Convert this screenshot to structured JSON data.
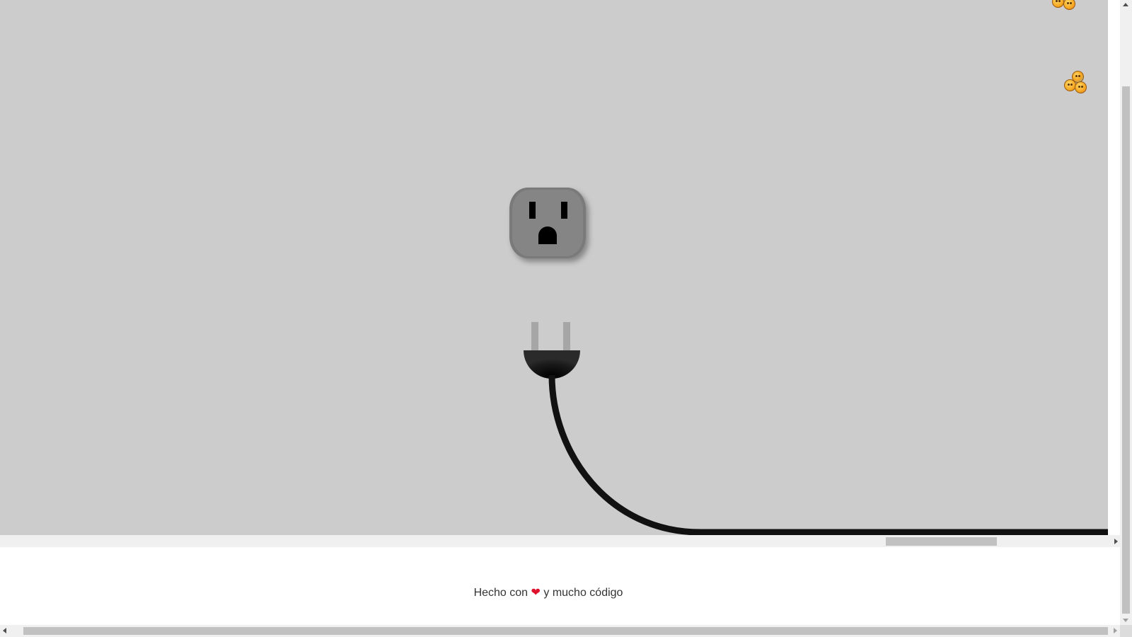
{
  "stage": {
    "background": "#cccccc"
  },
  "outlet": {
    "icon": "power-outlet-icon",
    "color": "#808080"
  },
  "plug": {
    "icon": "power-plug-icon",
    "color": "#111111",
    "prong_color": "#a6a6a6"
  },
  "emojis": [
    {
      "icon": "emoji-cluster-icon"
    },
    {
      "icon": "emoji-cluster-icon"
    }
  ],
  "footer": {
    "text_before": "Hecho con",
    "heart": "❤",
    "text_after": "y mucho código"
  },
  "colors": {
    "heart": "#e0112b",
    "footer_text": "#333333"
  }
}
